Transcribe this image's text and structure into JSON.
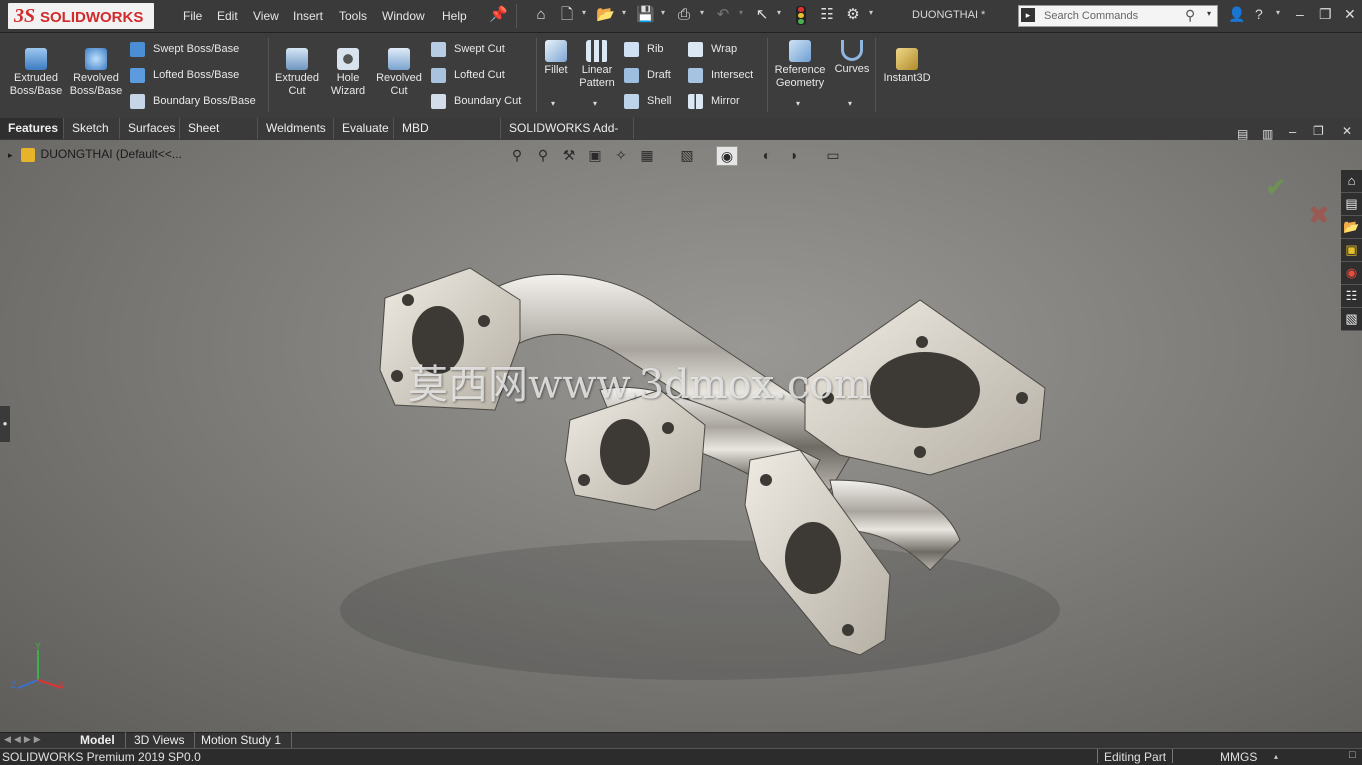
{
  "app": {
    "logo_mark": "3S",
    "logo_text": "SOLIDWORKS",
    "document_name": "DUONGTHAI *"
  },
  "menu": [
    "File",
    "Edit",
    "View",
    "Insert",
    "Tools",
    "Window",
    "Help"
  ],
  "search": {
    "placeholder": "Search Commands"
  },
  "features_toolbar": {
    "extruded_boss": "Extruded Boss/Base",
    "revolved_boss": "Revolved Boss/Base",
    "swept_boss": "Swept Boss/Base",
    "lofted_boss": "Lofted Boss/Base",
    "boundary_boss": "Boundary Boss/Base",
    "extruded_cut": "Extruded Cut",
    "hole_wizard": "Hole Wizard",
    "revolved_cut": "Revolved Cut",
    "swept_cut": "Swept Cut",
    "lofted_cut": "Lofted Cut",
    "boundary_cut": "Boundary Cut",
    "fillet": "Fillet",
    "linear_pattern": "Linear Pattern",
    "rib": "Rib",
    "draft": "Draft",
    "shell": "Shell",
    "wrap": "Wrap",
    "intersect": "Intersect",
    "mirror": "Mirror",
    "reference_geometry": "Reference Geometry",
    "curves": "Curves",
    "instant3d": "Instant3D"
  },
  "tabs": [
    "Features",
    "Sketch",
    "Surfaces",
    "Sheet Metal",
    "Weldments",
    "Evaluate",
    "MBD Dimensions",
    "SOLIDWORKS Add-Ins"
  ],
  "tree": {
    "root": "DUONGTHAI  (Default<<..."
  },
  "viewport": {
    "watermark": "莫西网www.3dmox.com"
  },
  "triad": {
    "x": "X",
    "y": "Y",
    "z": "Z"
  },
  "bottom_tabs": [
    "Model",
    "3D Views",
    "Motion Study 1"
  ],
  "status": {
    "product": "SOLIDWORKS Premium 2019 SP0.0",
    "mode": "Editing Part",
    "units": "MMGS"
  },
  "colors": {
    "brand_red": "#d12b2b",
    "accept_green": "#6aa63a",
    "cancel_red": "#c0392b"
  }
}
